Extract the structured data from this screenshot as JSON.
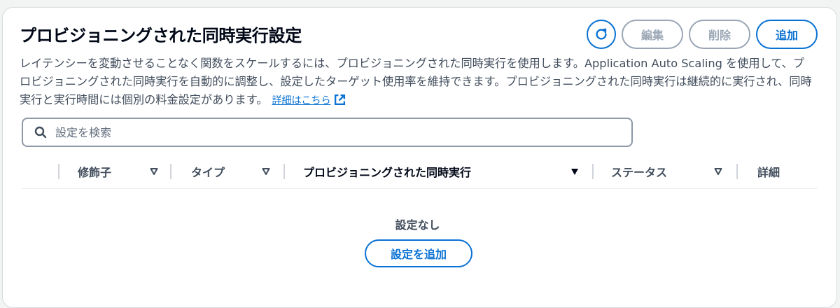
{
  "header": {
    "title": "プロビジョニングされた同時実行設定",
    "refresh_icon": "refresh-icon",
    "edit_label": "編集",
    "delete_label": "削除",
    "add_label": "追加"
  },
  "description": {
    "text": "レイテンシーを変動させることなく関数をスケールするには、プロビジョニングされた同時実行を使用します。Application Auto Scaling を使用して、プロビジョニングされた同時実行を自動的に調整し、設定したターゲット使用率を維持できます。プロビジョニングされた同時実行は継続的に実行され、同時実行と実行時間には個別の料金設定があります。",
    "link_label": "詳細はこちら",
    "link_icon": "external-link-icon"
  },
  "search": {
    "placeholder": "設定を検索",
    "value": "",
    "icon": "search-icon"
  },
  "table": {
    "columns": [
      {
        "label": "修飾子",
        "sort": "unsorted"
      },
      {
        "label": "タイプ",
        "sort": "unsorted"
      },
      {
        "label": "プロビジョニングされた同時実行",
        "sort": "sorted-descending"
      },
      {
        "label": "ステータス",
        "sort": "unsorted"
      },
      {
        "label": "詳細",
        "sort": "none"
      }
    ],
    "empty_title": "設定なし",
    "empty_action_label": "設定を追加"
  },
  "colors": {
    "accent": "#0972d3",
    "disabled": "#9ba7b6",
    "text": "#16191f"
  }
}
